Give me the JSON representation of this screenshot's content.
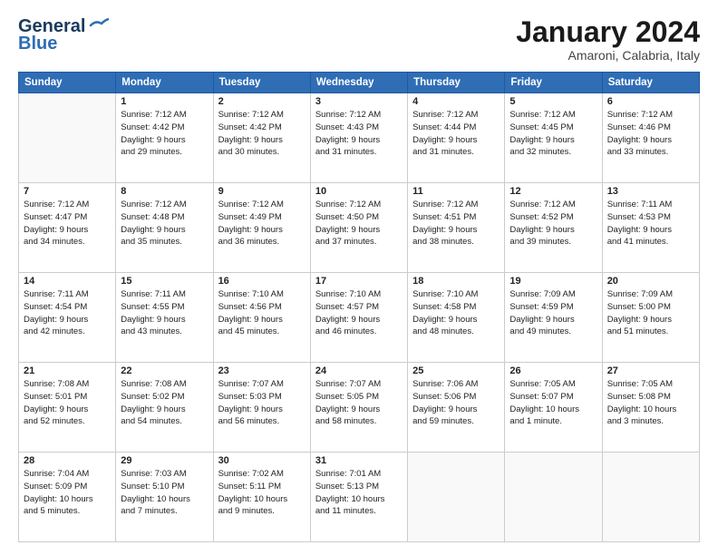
{
  "header": {
    "logo_line1": "General",
    "logo_line2": "Blue",
    "month_title": "January 2024",
    "location": "Amaroni, Calabria, Italy"
  },
  "days_of_week": [
    "Sunday",
    "Monday",
    "Tuesday",
    "Wednesday",
    "Thursday",
    "Friday",
    "Saturday"
  ],
  "weeks": [
    [
      {
        "day": "",
        "content": ""
      },
      {
        "day": "1",
        "content": "Sunrise: 7:12 AM\nSunset: 4:42 PM\nDaylight: 9 hours\nand 29 minutes."
      },
      {
        "day": "2",
        "content": "Sunrise: 7:12 AM\nSunset: 4:42 PM\nDaylight: 9 hours\nand 30 minutes."
      },
      {
        "day": "3",
        "content": "Sunrise: 7:12 AM\nSunset: 4:43 PM\nDaylight: 9 hours\nand 31 minutes."
      },
      {
        "day": "4",
        "content": "Sunrise: 7:12 AM\nSunset: 4:44 PM\nDaylight: 9 hours\nand 31 minutes."
      },
      {
        "day": "5",
        "content": "Sunrise: 7:12 AM\nSunset: 4:45 PM\nDaylight: 9 hours\nand 32 minutes."
      },
      {
        "day": "6",
        "content": "Sunrise: 7:12 AM\nSunset: 4:46 PM\nDaylight: 9 hours\nand 33 minutes."
      }
    ],
    [
      {
        "day": "7",
        "content": "Sunrise: 7:12 AM\nSunset: 4:47 PM\nDaylight: 9 hours\nand 34 minutes."
      },
      {
        "day": "8",
        "content": "Sunrise: 7:12 AM\nSunset: 4:48 PM\nDaylight: 9 hours\nand 35 minutes."
      },
      {
        "day": "9",
        "content": "Sunrise: 7:12 AM\nSunset: 4:49 PM\nDaylight: 9 hours\nand 36 minutes."
      },
      {
        "day": "10",
        "content": "Sunrise: 7:12 AM\nSunset: 4:50 PM\nDaylight: 9 hours\nand 37 minutes."
      },
      {
        "day": "11",
        "content": "Sunrise: 7:12 AM\nSunset: 4:51 PM\nDaylight: 9 hours\nand 38 minutes."
      },
      {
        "day": "12",
        "content": "Sunrise: 7:12 AM\nSunset: 4:52 PM\nDaylight: 9 hours\nand 39 minutes."
      },
      {
        "day": "13",
        "content": "Sunrise: 7:11 AM\nSunset: 4:53 PM\nDaylight: 9 hours\nand 41 minutes."
      }
    ],
    [
      {
        "day": "14",
        "content": "Sunrise: 7:11 AM\nSunset: 4:54 PM\nDaylight: 9 hours\nand 42 minutes."
      },
      {
        "day": "15",
        "content": "Sunrise: 7:11 AM\nSunset: 4:55 PM\nDaylight: 9 hours\nand 43 minutes."
      },
      {
        "day": "16",
        "content": "Sunrise: 7:10 AM\nSunset: 4:56 PM\nDaylight: 9 hours\nand 45 minutes."
      },
      {
        "day": "17",
        "content": "Sunrise: 7:10 AM\nSunset: 4:57 PM\nDaylight: 9 hours\nand 46 minutes."
      },
      {
        "day": "18",
        "content": "Sunrise: 7:10 AM\nSunset: 4:58 PM\nDaylight: 9 hours\nand 48 minutes."
      },
      {
        "day": "19",
        "content": "Sunrise: 7:09 AM\nSunset: 4:59 PM\nDaylight: 9 hours\nand 49 minutes."
      },
      {
        "day": "20",
        "content": "Sunrise: 7:09 AM\nSunset: 5:00 PM\nDaylight: 9 hours\nand 51 minutes."
      }
    ],
    [
      {
        "day": "21",
        "content": "Sunrise: 7:08 AM\nSunset: 5:01 PM\nDaylight: 9 hours\nand 52 minutes."
      },
      {
        "day": "22",
        "content": "Sunrise: 7:08 AM\nSunset: 5:02 PM\nDaylight: 9 hours\nand 54 minutes."
      },
      {
        "day": "23",
        "content": "Sunrise: 7:07 AM\nSunset: 5:03 PM\nDaylight: 9 hours\nand 56 minutes."
      },
      {
        "day": "24",
        "content": "Sunrise: 7:07 AM\nSunset: 5:05 PM\nDaylight: 9 hours\nand 58 minutes."
      },
      {
        "day": "25",
        "content": "Sunrise: 7:06 AM\nSunset: 5:06 PM\nDaylight: 9 hours\nand 59 minutes."
      },
      {
        "day": "26",
        "content": "Sunrise: 7:05 AM\nSunset: 5:07 PM\nDaylight: 10 hours\nand 1 minute."
      },
      {
        "day": "27",
        "content": "Sunrise: 7:05 AM\nSunset: 5:08 PM\nDaylight: 10 hours\nand 3 minutes."
      }
    ],
    [
      {
        "day": "28",
        "content": "Sunrise: 7:04 AM\nSunset: 5:09 PM\nDaylight: 10 hours\nand 5 minutes."
      },
      {
        "day": "29",
        "content": "Sunrise: 7:03 AM\nSunset: 5:10 PM\nDaylight: 10 hours\nand 7 minutes."
      },
      {
        "day": "30",
        "content": "Sunrise: 7:02 AM\nSunset: 5:11 PM\nDaylight: 10 hours\nand 9 minutes."
      },
      {
        "day": "31",
        "content": "Sunrise: 7:01 AM\nSunset: 5:13 PM\nDaylight: 10 hours\nand 11 minutes."
      },
      {
        "day": "",
        "content": ""
      },
      {
        "day": "",
        "content": ""
      },
      {
        "day": "",
        "content": ""
      }
    ]
  ]
}
